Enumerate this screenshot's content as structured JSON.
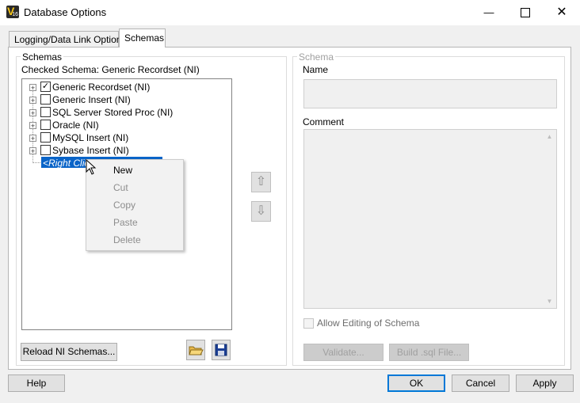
{
  "window": {
    "title": "Database Options",
    "app_icon_letter": "V",
    "app_icon_number": "16"
  },
  "tabs": [
    {
      "label": "Logging/Data Link Options",
      "active": false
    },
    {
      "label": "Schemas",
      "active": true
    }
  ],
  "schemas_group": {
    "legend": "Schemas",
    "checked_schema_label": "Checked Schema: Generic Recordset (NI)",
    "tree": [
      {
        "label": "Generic Recordset (NI)",
        "checked": true,
        "mark": "✓"
      },
      {
        "label": "Generic Insert (NI)",
        "checked": false
      },
      {
        "label": "SQL Server Stored Proc (NI)",
        "checked": false
      },
      {
        "label": "Oracle (NI)",
        "checked": false
      },
      {
        "label": "MySQL Insert (NI)",
        "checked": false
      },
      {
        "label": "Sybase Insert (NI)",
        "checked": false
      }
    ],
    "expander_symbol": "+",
    "editing_node_text": "<Right Click",
    "reload_button": "Reload NI Schemas...",
    "move_up_arrow": "⇧",
    "move_down_arrow": "⇩"
  },
  "context_menu": {
    "items": [
      {
        "label": "New",
        "enabled": true
      },
      {
        "label": "Cut",
        "enabled": false
      },
      {
        "label": "Copy",
        "enabled": false
      },
      {
        "label": "Paste",
        "enabled": false
      },
      {
        "label": "Delete",
        "enabled": false
      }
    ]
  },
  "schema_group": {
    "legend": "Schema",
    "name_label": "Name",
    "comment_label": "Comment",
    "allow_editing_label": "Allow Editing of Schema",
    "validate_button": "Validate...",
    "build_sql_button": "Build .sql File...",
    "scroll_up_glyph": "▲",
    "scroll_down_glyph": "▼"
  },
  "footer": {
    "help": "Help",
    "ok": "OK",
    "cancel": "Cancel",
    "apply": "Apply"
  },
  "title_controls": {
    "minimize_glyph": "—",
    "close_glyph": "✕"
  },
  "colors": {
    "accent": "#0078d7",
    "selection": "#0a64c8"
  }
}
